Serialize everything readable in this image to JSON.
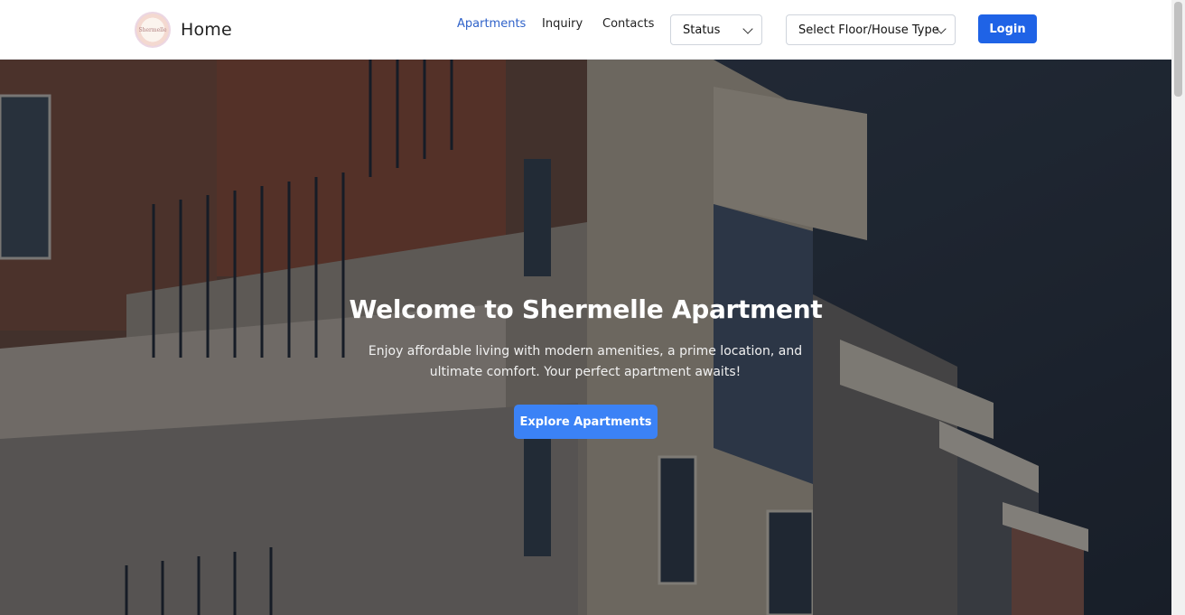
{
  "nav": {
    "brand_title": "Home",
    "logo_text": "Shermelle",
    "links": [
      {
        "label": "Apartments",
        "active": true
      },
      {
        "label": "Inquiry",
        "active": false
      },
      {
        "label": "Contacts",
        "active": false
      }
    ],
    "status_select": {
      "value": "Status"
    },
    "floor_select": {
      "value": "Select Floor/House Type"
    },
    "login_label": "Login"
  },
  "hero": {
    "title": "Welcome to Shermelle Apartment",
    "subtitle": "Enjoy affordable living with modern amenities, a prime location, and ultimate comfort. Your perfect apartment awaits!",
    "cta_label": "Explore Apartments"
  },
  "colors": {
    "accent": "#1f63e6",
    "cta": "#3b82f6",
    "active_link": "#2f62c9"
  }
}
